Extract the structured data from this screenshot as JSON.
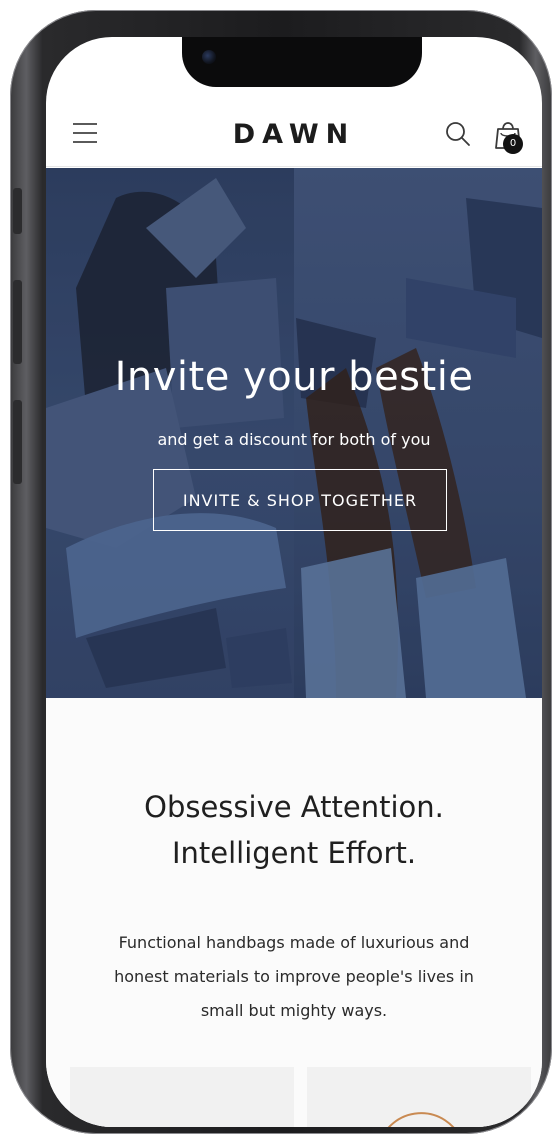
{
  "header": {
    "brand": "DAWN",
    "cart_count": "0"
  },
  "hero": {
    "title": "Invite your bestie",
    "subtitle": "and get a discount for both of you",
    "button_label": "INVITE & SHOP TOGETHER"
  },
  "intro": {
    "heading_line1": "Obsessive Attention.",
    "heading_line2": "Intelligent Effort.",
    "body_line1": "Functional handbags made of luxurious and",
    "body_line2": "honest materials to improve people's lives in",
    "body_line3": "small but mighty ways."
  },
  "icons": [
    "menu-icon",
    "search-icon",
    "cart-icon"
  ],
  "colors": {
    "hero_blue": "#3c5076",
    "text_dark": "#1f1f1f",
    "badge": "#121212"
  }
}
